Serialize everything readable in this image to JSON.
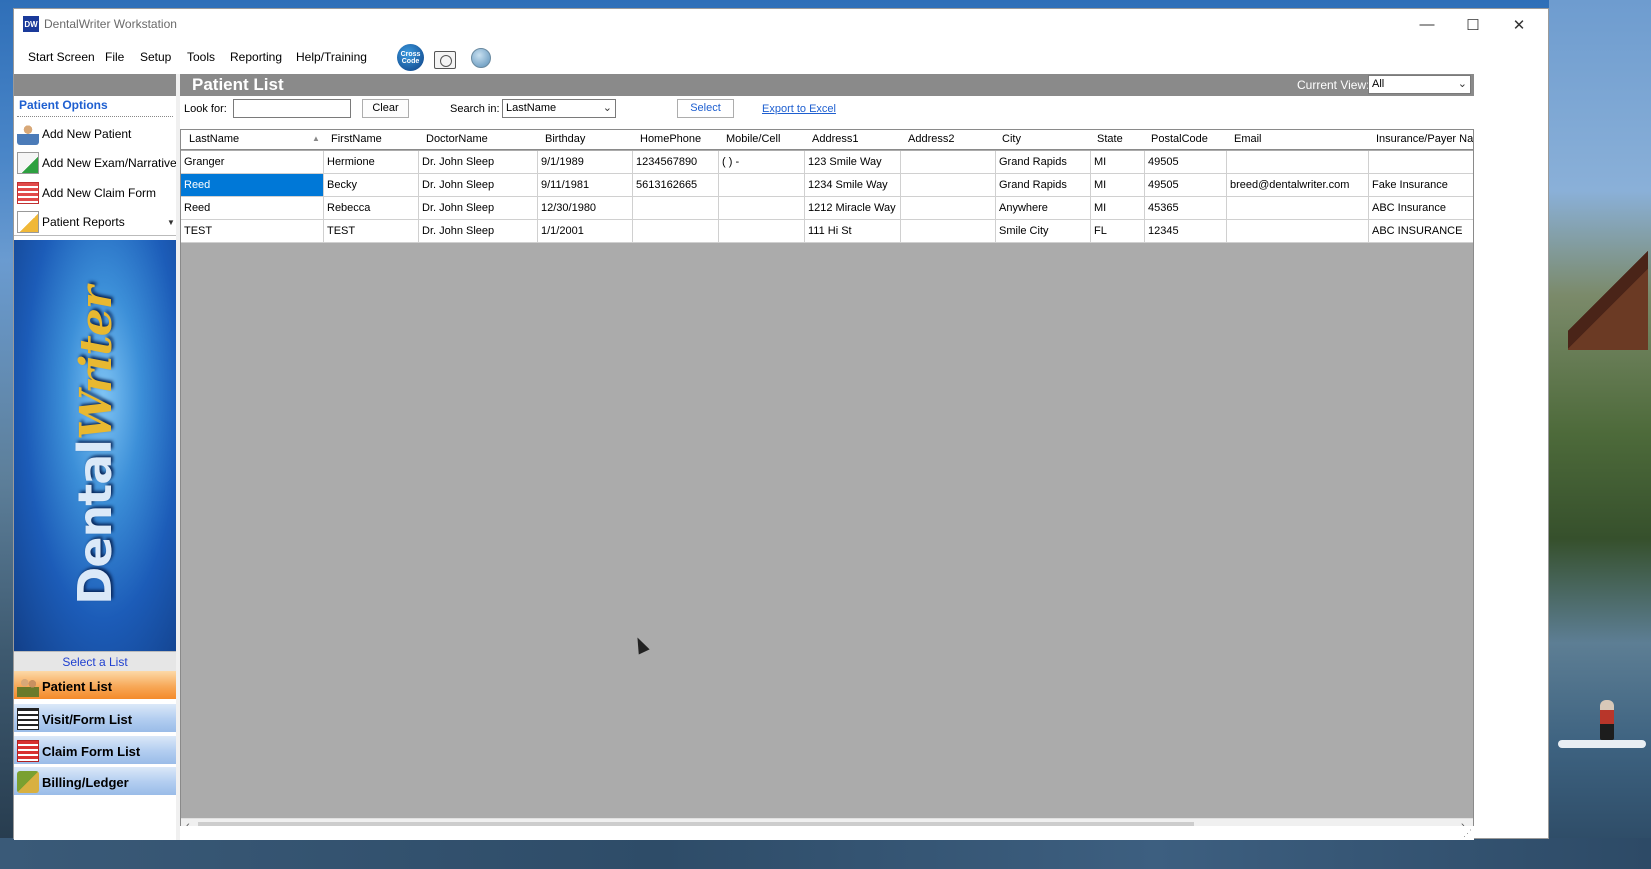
{
  "window": {
    "title": "DentalWriter Workstation",
    "icon_text": "DW",
    "minimize": "—",
    "maximize": "☐",
    "close": "✕"
  },
  "menu": [
    {
      "label": "Start Screen"
    },
    {
      "label": "File"
    },
    {
      "label": "Setup"
    },
    {
      "label": "Tools"
    },
    {
      "label": "Reporting"
    },
    {
      "label": "Help/Training"
    }
  ],
  "toolbar": {
    "code_icon_text": "Cross Code",
    "icons": [
      "cross-code-icon",
      "camera-icon",
      "help-globe-icon"
    ]
  },
  "sidebar": {
    "header": "Patient Options",
    "options": [
      {
        "label": "Add New Patient",
        "icon": "person-icon"
      },
      {
        "label": "Add New Exam/Narrative",
        "icon": "exam-icon"
      },
      {
        "label": "Add New Claim Form",
        "icon": "claim-form-icon"
      },
      {
        "label": "Patient Reports",
        "icon": "report-icon"
      }
    ],
    "logo_text_main": "Dental",
    "logo_text_accent": "Writer",
    "select_list": "Select a List",
    "nav": [
      {
        "label": "Patient List",
        "icon": "patients-icon",
        "active": true
      },
      {
        "label": "Visit/Form List",
        "icon": "list-icon"
      },
      {
        "label": "Claim Form List",
        "icon": "claim-list-icon"
      },
      {
        "label": "Billing/Ledger",
        "icon": "billing-icon"
      }
    ]
  },
  "main": {
    "title": "Patient List",
    "current_view_label": "Current View:",
    "current_view_value": "All",
    "look_for_label": "Look for:",
    "look_for_value": "",
    "clear_label": "Clear",
    "search_in_label": "Search in:",
    "search_in_value": "LastName",
    "select_label": "Select",
    "export_label": "Export to Excel"
  },
  "grid": {
    "columns": [
      "LastName",
      "FirstName",
      "DoctorName",
      "Birthday",
      "HomePhone",
      "Mobile/Cell",
      "Address1",
      "Address2",
      "City",
      "State",
      "PostalCode",
      "Email",
      "Insurance/Payer Nam"
    ],
    "rows": [
      [
        "Granger",
        "Hermione",
        "Dr. John Sleep",
        "9/1/1989",
        "1234567890",
        "(   )   -",
        "123 Smile Way",
        "",
        "Grand Rapids",
        "MI",
        "49505",
        "",
        ""
      ],
      [
        "Reed",
        "Becky",
        "Dr. John Sleep",
        "9/11/1981",
        "5613162665",
        "",
        "1234 Smile Way",
        "",
        "Grand Rapids",
        "MI",
        "49505",
        "breed@dentalwriter.com",
        "Fake Insurance"
      ],
      [
        "Reed",
        "Rebecca",
        "Dr. John Sleep",
        "12/30/1980",
        "",
        "",
        "1212 Miracle Way",
        "",
        "Anywhere",
        "MI",
        "45365",
        "",
        "ABC Insurance"
      ],
      [
        "TEST",
        "TEST",
        "Dr. John Sleep",
        "1/1/2001",
        "",
        "",
        "111 Hi St",
        "",
        "Smile City",
        "FL",
        "12345",
        "",
        "ABC INSURANCE"
      ]
    ],
    "selected_row": 1,
    "selected_col": 0
  },
  "scrollbar": {
    "left_arrow": "‹",
    "right_arrow": "›"
  },
  "colors": {
    "selection": "#0078d7",
    "link": "#1e5fd0",
    "header_bar": "#8a8a8a",
    "active_nav": "#f48a2a"
  }
}
